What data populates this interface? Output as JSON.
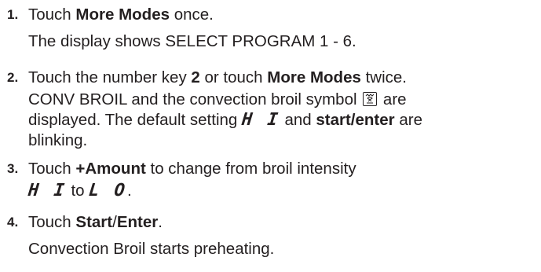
{
  "steps": [
    {
      "number": "1.",
      "lines": [
        {
          "pre": "Touch ",
          "bold": "More Modes",
          "post": " once."
        },
        {
          "plain": "The display shows SELECT PROGRAM 1 - 6."
        }
      ]
    },
    {
      "number": "2.",
      "lines": [
        {
          "pre": "Touch the number key ",
          "bold1": "2",
          "mid": " or touch ",
          "bold2": "More Modes",
          "post": " twice."
        },
        {
          "pre": "CONV BROIL and the convection broil symbol ",
          "post": " are"
        },
        {
          "plain": "displayed. The default setting",
          "seg": "H I",
          "mid": " and ",
          "bold": "start/enter",
          "post": " are"
        },
        {
          "plain": "blinking."
        }
      ],
      "symbol_icon": "convection-broil-icon"
    },
    {
      "number": "3.",
      "lines": [
        {
          "pre": "Touch ",
          "bold": "+Amount",
          "post": " to change from broil intensity"
        },
        {
          "seg1": "H I",
          "mid": " to ",
          "seg2": "L O",
          "post": "."
        }
      ]
    },
    {
      "number": "4.",
      "lines": [
        {
          "pre": "Touch ",
          "bold": "Start",
          "sep": "/",
          "bold2": "Enter",
          "post": "."
        },
        {
          "plain": "Convection Broil starts preheating."
        }
      ]
    }
  ]
}
